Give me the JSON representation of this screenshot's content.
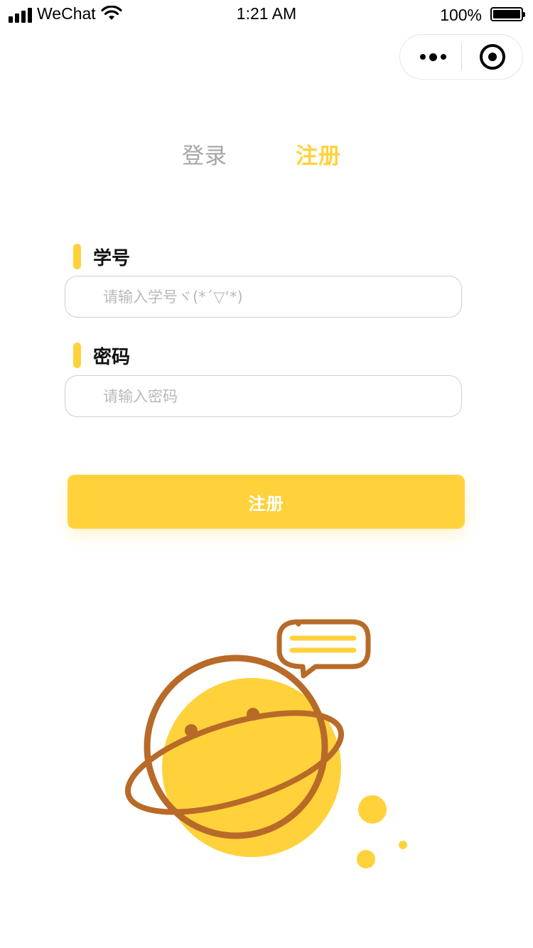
{
  "status_bar": {
    "carrier": "WeChat",
    "time": "1:21 AM",
    "battery_percent": "100%",
    "battery_level": 1.0
  },
  "capsule": {
    "more_icon": "more-dots-icon",
    "close_icon": "target-circle-icon"
  },
  "tabs": [
    {
      "label": "登录",
      "active": false
    },
    {
      "label": "注册",
      "active": true
    }
  ],
  "form": {
    "student_id": {
      "label": "学号",
      "value": "",
      "placeholder": "请输入学号ヾ(*´▽‘*)"
    },
    "password": {
      "label": "密码",
      "value": "",
      "placeholder": "请输入密码"
    },
    "submit_label": "注册"
  },
  "colors": {
    "accent": "#ffd23c",
    "planet_outline": "#b86a28",
    "inactive_tab": "#a5a5a5"
  },
  "illustration": {
    "icon": "planet-speech-bubble-illustration"
  }
}
